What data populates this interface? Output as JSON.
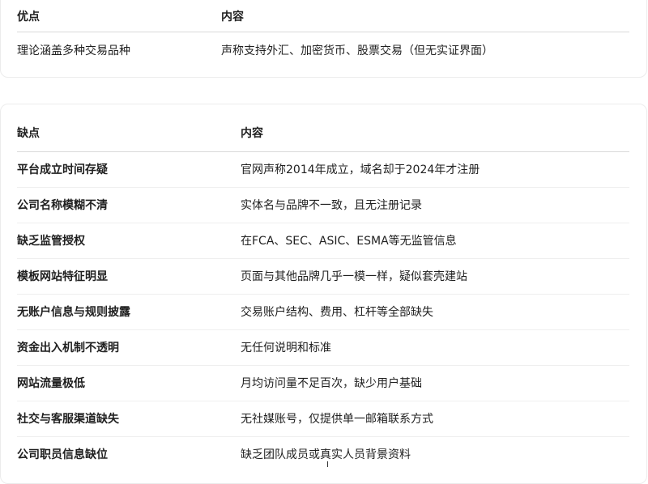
{
  "pros_table": {
    "headers": [
      "优点",
      "内容"
    ],
    "rows": [
      [
        "理论涵盖多种交易品种",
        "声称支持外汇、加密货币、股票交易（但无实证界面）"
      ]
    ]
  },
  "cons_table": {
    "headers": [
      "缺点",
      "内容"
    ],
    "rows": [
      [
        "平台成立时间存疑",
        "官网声称2014年成立，域名却于2024年才注册"
      ],
      [
        "公司名称模糊不清",
        "实体名与品牌不一致，且无注册记录"
      ],
      [
        "缺乏监管授权",
        "在FCA、SEC、ASIC、ESMA等无监管信息"
      ],
      [
        "模板网站特征明显",
        "页面与其他品牌几乎一模一样，疑似套壳建站"
      ],
      [
        "无账户信息与规则披露",
        "交易账户结构、费用、杠杆等全部缺失"
      ],
      [
        "资金出入机制不透明",
        "无任何说明和标准"
      ],
      [
        "网站流量极低",
        "月均访问量不足百次，缺少用户基础"
      ],
      [
        "社交与客服渠道缺失",
        "无社媒账号，仅提供单一邮箱联系方式"
      ],
      [
        "公司职员信息缺位",
        "缺乏团队成员或真实人员背景资料"
      ]
    ]
  }
}
